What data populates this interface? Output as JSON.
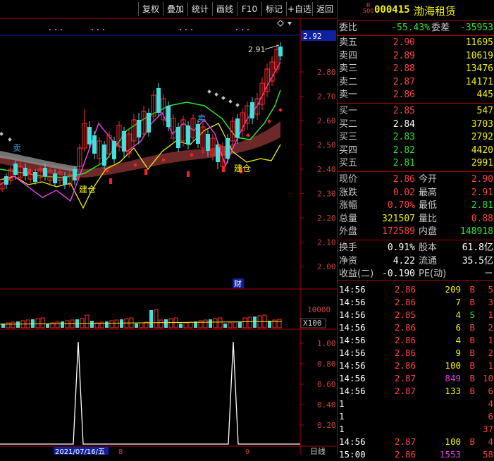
{
  "toolbar": {
    "items": [
      "复权",
      "叠加",
      "统计",
      "画线",
      "F10",
      "标记",
      "+自选",
      "返回"
    ]
  },
  "chart": {
    "current_price_tag": "2.92",
    "peak_label": "2.91",
    "price_axis": [
      "2.80",
      "2.70",
      "2.60",
      "2.50",
      "2.40",
      "2.30",
      "2.20",
      "2.10",
      "2.00"
    ],
    "volume_axis": [
      "10000"
    ],
    "volume_unit": "X100",
    "indicator_axis": [
      "1.00",
      "0.80",
      "0.60",
      "0.40",
      "0.20"
    ],
    "date_label": "2021/07/16/五",
    "month_labels": [
      "8",
      "9"
    ],
    "period_label": "日线",
    "signals": {
      "buy": "建仓",
      "sell": "卖",
      "finance": "财"
    },
    "colors": {
      "up": "#ff3030",
      "down": "#40e0e0",
      "ma_green": "#30e030",
      "ma_yellow": "#f0f000",
      "ma_magenta": "#e040e0"
    }
  },
  "quote": {
    "badge_top": "R",
    "badge_bottom": "500",
    "code": "000415",
    "name": "渤海租赁",
    "webi_label": "委比",
    "webi": "-55.43%",
    "weicha_label": "委差",
    "weicha": "-35953",
    "asks": [
      {
        "label": "卖五",
        "price": "2.90",
        "vol": "11695"
      },
      {
        "label": "卖四",
        "price": "2.89",
        "vol": "10619"
      },
      {
        "label": "卖三",
        "price": "2.88",
        "vol": "13476"
      },
      {
        "label": "卖二",
        "price": "2.87",
        "vol": "14171"
      },
      {
        "label": "卖一",
        "price": "2.86",
        "vol": "445"
      }
    ],
    "bids": [
      {
        "label": "买一",
        "price": "2.85",
        "vol": "547"
      },
      {
        "label": "买二",
        "price": "2.84",
        "vol": "3703"
      },
      {
        "label": "买三",
        "price": "2.83",
        "vol": "2792"
      },
      {
        "label": "买四",
        "price": "2.82",
        "vol": "4420"
      },
      {
        "label": "买五",
        "price": "2.81",
        "vol": "2991"
      }
    ],
    "stats": [
      {
        "l1": "现价",
        "v1": "2.86",
        "l2": "今开",
        "v2": "2.90"
      },
      {
        "l1": "涨跌",
        "v1": "0.02",
        "l2": "最高",
        "v2": "2.91"
      },
      {
        "l1": "涨幅",
        "v1": "0.70%",
        "l2": "最低",
        "v2": "2.81"
      },
      {
        "l1": "总量",
        "v1": "321507",
        "l2": "量比",
        "v2": "0.88"
      },
      {
        "l1": "外盘",
        "v1": "172589",
        "l2": "内盘",
        "v2": "148918"
      }
    ],
    "fund": [
      {
        "l1": "换手",
        "v1": "0.91%",
        "l2": "股本",
        "v2": "61.8亿"
      },
      {
        "l1": "净资",
        "v1": "4.22",
        "l2": "流通",
        "v2": "35.5亿"
      },
      {
        "l1": "收益(二)",
        "v1": "-0.190",
        "l2": "PE(动)",
        "v2": "－"
      }
    ],
    "ticks": [
      {
        "time": "14:56",
        "price": "2.86",
        "vol": "209",
        "bs": "B",
        "n": "5"
      },
      {
        "time": "14:56",
        "price": "2.86",
        "vol": "7",
        "bs": "B",
        "n": "3"
      },
      {
        "time": "14:56",
        "price": "2.85",
        "vol": "4",
        "bs": "S",
        "n": "1"
      },
      {
        "time": "14:56",
        "price": "2.86",
        "vol": "6",
        "bs": "B",
        "n": "2"
      },
      {
        "time": "14:56",
        "price": "2.86",
        "vol": "4",
        "bs": "B",
        "n": "1"
      },
      {
        "time": "14:56",
        "price": "2.86",
        "vol": "9",
        "bs": "B",
        "n": "2"
      },
      {
        "time": "14:56",
        "price": "2.86",
        "vol": "100",
        "bs": "B",
        "n": "1"
      },
      {
        "time": "14:56",
        "price": "2.87",
        "vol": "849",
        "bs": "B",
        "n": "10"
      },
      {
        "time": "14:56",
        "price": "2.87",
        "vol": "133",
        "bs": "B",
        "n": "6"
      },
      {
        "time": "1",
        "price": "",
        "vol": "",
        "bs": "",
        "n": "4"
      },
      {
        "time": "1",
        "price": "",
        "vol": "",
        "bs": "",
        "n": "6"
      },
      {
        "time": "1",
        "price": "",
        "vol": "",
        "bs": "",
        "n": "37"
      },
      {
        "time": "14:56",
        "price": "2.87",
        "vol": "100",
        "bs": "B",
        "n": "4"
      },
      {
        "time": "15:00",
        "price": "2.86",
        "vol": "1553",
        "bs": "",
        "n": "58"
      }
    ]
  }
}
